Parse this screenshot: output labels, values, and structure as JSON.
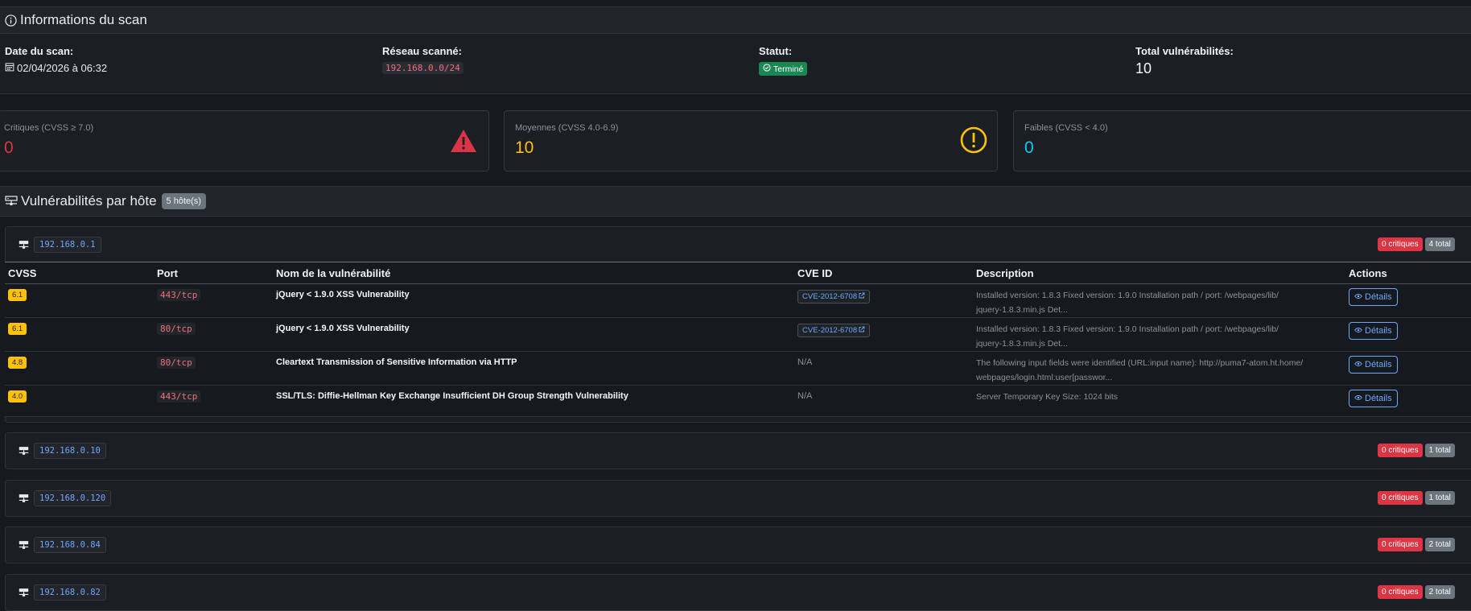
{
  "scan_info": {
    "title": "Informations du scan",
    "date_label": "Date du scan:",
    "date_value": "02/04/2026 à 06:32",
    "network_label": "Réseau scanné:",
    "network_value": "192.168.0.0/24",
    "status_label": "Statut:",
    "status_value": "Terminé",
    "total_label": "Total vulnérabilités:",
    "total_value": "10"
  },
  "stats": [
    {
      "label": "Critiques (CVSS ≥ 7.0)",
      "value": "0",
      "color": "#dc3545",
      "icon": "warning-triangle-icon"
    },
    {
      "label": "Moyennes (CVSS 4.0-6.9)",
      "value": "10",
      "color": "#ffc107",
      "icon": "exclamation-circle-icon"
    },
    {
      "label": "Faibles (CVSS < 4.0)",
      "value": "0",
      "color": "#0dcaf0",
      "icon": "info-icon"
    }
  ],
  "hosts_section": {
    "title": "Vulnérabilités par hôte",
    "count_badge": "5 hôte(s)"
  },
  "table_headers": {
    "cvss": "CVSS",
    "port": "Port",
    "name": "Nom de la vulnérabilité",
    "cve": "CVE ID",
    "description": "Description",
    "actions": "Actions"
  },
  "hosts": [
    {
      "ip": "192.168.0.1",
      "critical": "0 critiques",
      "total": "4 total"
    },
    {
      "ip": "192.168.0.10",
      "critical": "0 critiques",
      "total": "1 total"
    },
    {
      "ip": "192.168.0.120",
      "critical": "0 critiques",
      "total": "1 total"
    },
    {
      "ip": "192.168.0.84",
      "critical": "0 critiques",
      "total": "2 total"
    },
    {
      "ip": "192.168.0.82",
      "critical": "0 critiques",
      "total": "2 total"
    }
  ],
  "vulns": [
    {
      "cvss": "6.1",
      "port": "443/tcp",
      "name": "jQuery < 1.9.0 XSS Vulnerability",
      "cve": "CVE-2012-6708",
      "desc1": "Installed version: 1.8.3 Fixed version: 1.9.0 Installation path / port: /webpages/lib/",
      "desc2": "jquery-1.8.3.min.js Det...",
      "action": "Détails"
    },
    {
      "cvss": "6.1",
      "port": "80/tcp",
      "name": "jQuery < 1.9.0 XSS Vulnerability",
      "cve": "CVE-2012-6708",
      "desc1": "Installed version: 1.8.3 Fixed version: 1.9.0 Installation path / port: /webpages/lib/",
      "desc2": "jquery-1.8.3.min.js Det...",
      "action": "Détails"
    },
    {
      "cvss": "4.8",
      "port": "80/tcp",
      "name": "Cleartext Transmission of Sensitive Information via HTTP",
      "cve": "N/A",
      "desc1": "The following input fields were identified (URL:input name): http://puma7-atom.ht.home/",
      "desc2": "webpages/login.html:user[passwor...",
      "action": "Détails"
    },
    {
      "cvss": "4.0",
      "port": "443/tcp",
      "name": "SSL/TLS: Diffie-Hellman Key Exchange Insufficient DH Group Strength Vulnerability",
      "cve": "N/A",
      "desc1": "Server Temporary Key Size: 1024 bits",
      "desc2": "",
      "action": "Détails"
    }
  ]
}
